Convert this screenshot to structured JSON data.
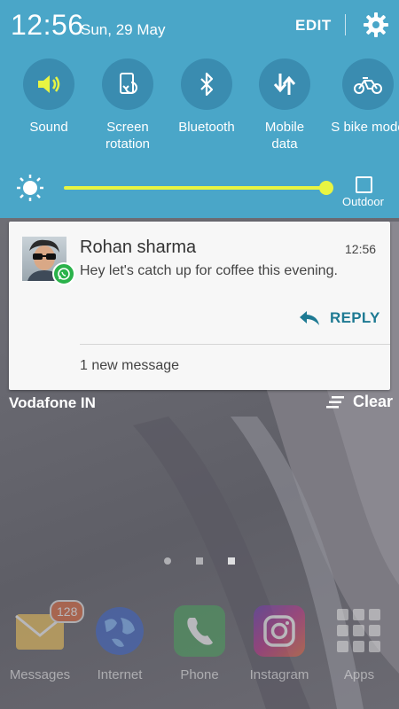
{
  "status": {
    "time": "12:56",
    "date": "Sun, 29 May",
    "edit_label": "EDIT"
  },
  "quick_settings": [
    {
      "label": "Sound",
      "icon": "volume-icon",
      "active": true
    },
    {
      "label": "Screen\nrotation",
      "icon": "rotation-icon",
      "active": false
    },
    {
      "label": "Bluetooth",
      "icon": "bluetooth-icon",
      "active": false
    },
    {
      "label": "Mobile\ndata",
      "icon": "mobile-data-icon",
      "active": false
    },
    {
      "label": "S bike mode",
      "icon": "bike-icon",
      "active": false
    }
  ],
  "brightness": {
    "level": 0.98,
    "outdoor_label": "Outdoor"
  },
  "notification": {
    "sender": "Rohan sharma",
    "time": "12:56",
    "message": "Hey let's catch up for coffee this evening.",
    "reply_label": "REPLY",
    "summary": "1 new message",
    "app_icon": "whatsapp-icon"
  },
  "carrier": "Vodafone IN",
  "clear_label": "Clear",
  "dock": [
    {
      "label": "Messages",
      "icon": "messages-icon",
      "badge": "128"
    },
    {
      "label": "Internet",
      "icon": "internet-icon"
    },
    {
      "label": "Phone",
      "icon": "phone-icon"
    },
    {
      "label": "Instagram",
      "icon": "instagram-icon"
    },
    {
      "label": "Apps",
      "icon": "apps-grid-icon"
    }
  ],
  "colors": {
    "panel": "#4aa6c8",
    "tile": "#3a8cb0",
    "accent_active": "#e8f542",
    "reply": "#1e7a93",
    "whatsapp": "#2ab24a"
  }
}
